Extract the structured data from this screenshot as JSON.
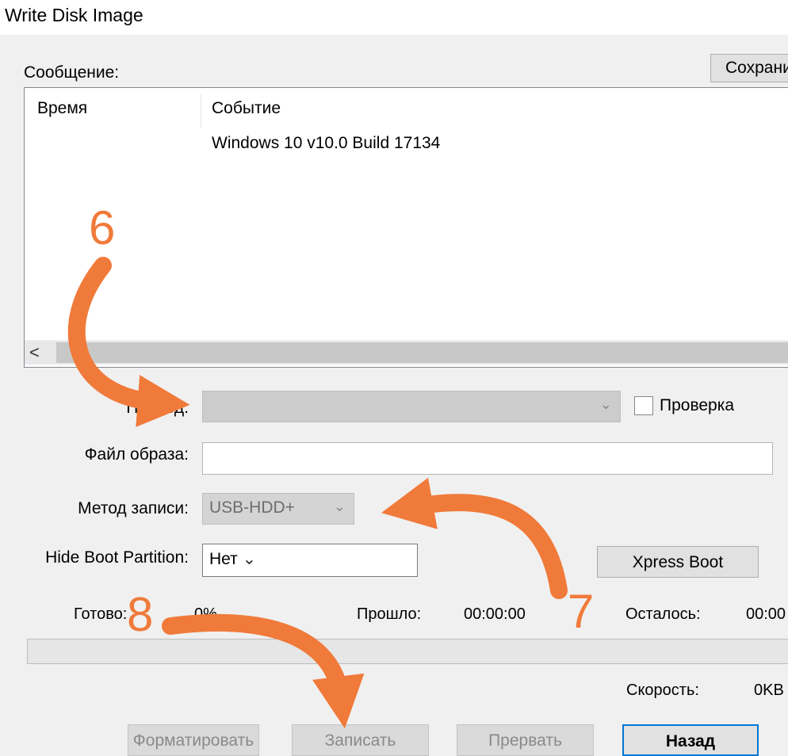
{
  "window": {
    "title": "Write Disk Image"
  },
  "messages": {
    "label": "Сообщение:",
    "save_label": "Сохрани",
    "columns": [
      "Время",
      "Событие"
    ],
    "rows": [
      {
        "time": "",
        "event": "Windows 10 v10.0 Build 17134"
      }
    ],
    "scroll_left": "<"
  },
  "form": {
    "drive": {
      "label": "Привод:",
      "value": "",
      "verify_label": "Проверка"
    },
    "image_file": {
      "label": "Файл образа:",
      "value": ""
    },
    "write_method": {
      "label": "Метод записи:",
      "value": "USB-HDD+"
    },
    "hide_boot": {
      "label": "Hide Boot Partition:",
      "value": "Нет"
    },
    "xpress_boot_label": "Xpress Boot"
  },
  "status": {
    "done_label": "Готово:",
    "done_value": "0%",
    "elapsed_label": "Прошло:",
    "elapsed_value": "00:00:00",
    "remaining_label": "Осталось:",
    "remaining_value": "00:00",
    "speed_label": "Скорость:",
    "speed_value": "0KB",
    "progress": 0
  },
  "buttons": {
    "format": "Форматировать",
    "write": "Записать",
    "abort": "Прервать",
    "back": "Назад"
  },
  "annotations": {
    "n6": "6",
    "n7": "7",
    "n8": "8",
    "color": "#f07a3a"
  },
  "icons": {
    "dropdown": "chevron-down-icon"
  }
}
